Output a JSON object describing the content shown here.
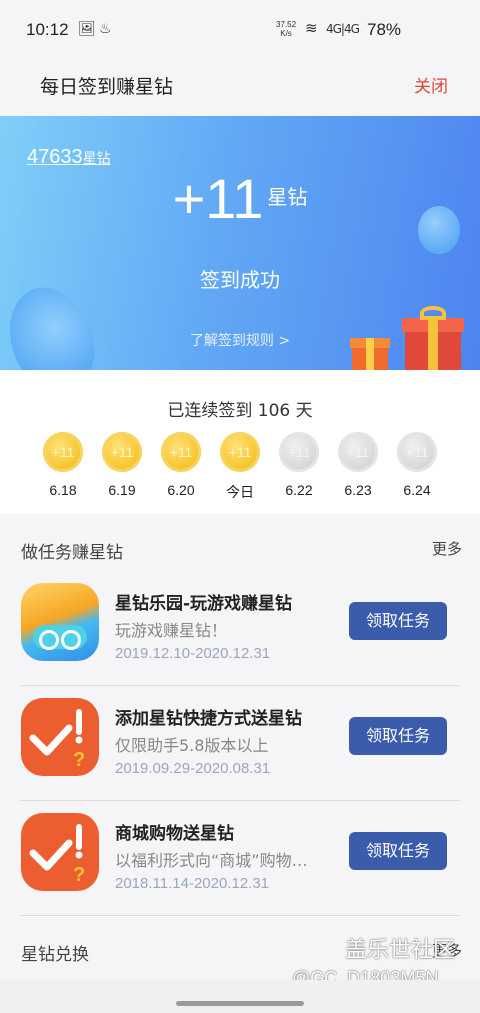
{
  "status_bar": {
    "time": "10:12",
    "net_speed_value": "37.52",
    "net_speed_unit": "K/s",
    "signal": "4G|4G",
    "battery": "78%"
  },
  "header": {
    "title": "每日签到赚星钻",
    "close_label": "关闭"
  },
  "banner": {
    "balance_value": "47633",
    "balance_unit": "星钻",
    "gain_value": "+11",
    "gain_unit": "星钻",
    "success_text": "签到成功",
    "rules_link": "了解签到规则 >"
  },
  "streak": {
    "text": "已连续签到 106 天",
    "days": [
      {
        "reward": "+11",
        "label": "6.18",
        "checked": true
      },
      {
        "reward": "+11",
        "label": "6.19",
        "checked": true
      },
      {
        "reward": "+11",
        "label": "6.20",
        "checked": true
      },
      {
        "reward": "+11",
        "label": "今日",
        "checked": true
      },
      {
        "reward": "+11",
        "label": "6.22",
        "checked": false
      },
      {
        "reward": "+11",
        "label": "6.23",
        "checked": false
      },
      {
        "reward": "+11",
        "label": "6.24",
        "checked": false
      }
    ]
  },
  "tasks": {
    "section_title": "做任务赚星钻",
    "more_label": "更多",
    "items": [
      {
        "title": "星钻乐园-玩游戏赚星钻",
        "desc": "玩游戏赚星钻！",
        "date": "2019.12.10-2020.12.31",
        "button": "领取任务",
        "icon": "game-controller-icon"
      },
      {
        "title": "添加星钻快捷方式送星钻",
        "desc": "仅限助手5.8版本以上",
        "date": "2019.09.29-2020.08.31",
        "button": "领取任务",
        "icon": "check-alert-icon"
      },
      {
        "title": "商城购物送星钻",
        "desc": "以福利形式向“商城”购物用户赠送星钻",
        "date": "2018.11.14-2020.12.31",
        "button": "领取任务",
        "icon": "check-alert-icon"
      }
    ]
  },
  "exchange": {
    "title": "星钻兑换",
    "more_label": "更多"
  },
  "watermark": {
    "line1": "盖乐世社区",
    "line2": "@GC_D1803M5N"
  },
  "colors": {
    "accent_button": "#3b5bab",
    "close_red": "#d9483b",
    "banner_start": "#7fcff8",
    "banner_end": "#4d84f0",
    "coin_gold": "#f8c630",
    "coin_grey": "#d9d9d9"
  }
}
